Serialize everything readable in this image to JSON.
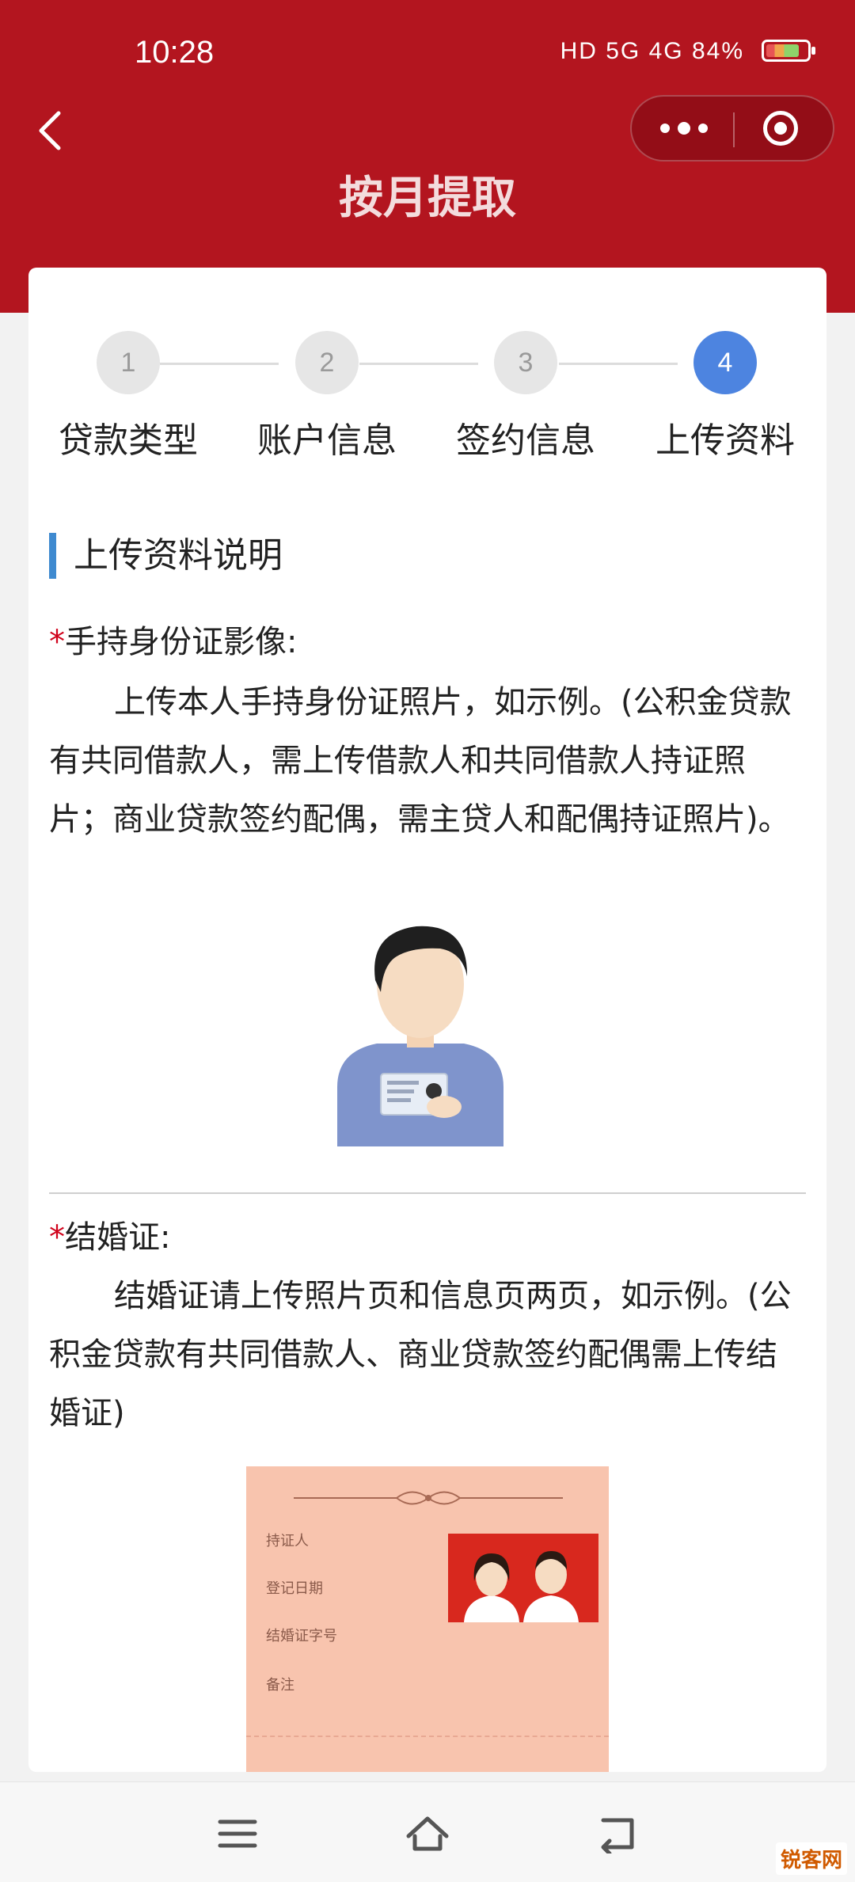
{
  "status_bar": {
    "time": "10:28",
    "network": "HD 5G 4G",
    "battery": "84%",
    "battery_level": 0.84
  },
  "header": {
    "title": "按月提取"
  },
  "steps": [
    {
      "number": "1",
      "label": "贷款类型",
      "active": false
    },
    {
      "number": "2",
      "label": "账户信息",
      "active": false
    },
    {
      "number": "3",
      "label": "签约信息",
      "active": false
    },
    {
      "number": "4",
      "label": "上传资料",
      "active": true
    }
  ],
  "section": {
    "title": "上传资料说明"
  },
  "id_photo": {
    "required_mark": "*",
    "title": "手持身份证影像:",
    "description": "上传本人手持身份证照片，如示例。(公积金贷款有共同借款人，需上传借款人和共同借款人持证照片；商业贷款签约配偶，需主贷人和配偶持证照片)。"
  },
  "marriage_cert": {
    "required_mark": "*",
    "title": "结婚证:",
    "description": "结婚证请上传照片页和信息页两页，如示例。(公积金贷款有共同借款人、商业贷款签约配偶需上传结婚证)",
    "fields": [
      "持证人",
      "登记日期",
      "结婚证字号",
      "备注"
    ]
  },
  "colors": {
    "header_red": "#b3151f",
    "step_active": "#4d84e0",
    "section_accent": "#3f8ad0",
    "required": "#d0021b"
  },
  "watermark": "锐客网"
}
